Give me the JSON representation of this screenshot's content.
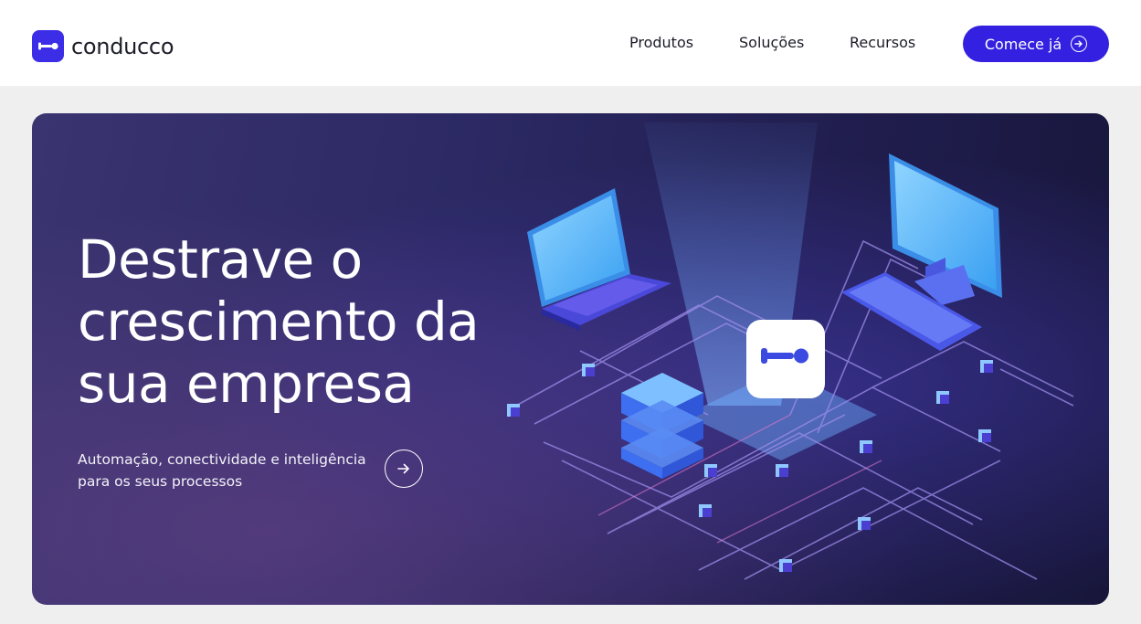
{
  "brand": {
    "name": "conducco",
    "color": "#3b2ee6"
  },
  "nav": {
    "items": [
      {
        "label": "Produtos"
      },
      {
        "label": "Soluções"
      },
      {
        "label": "Recursos"
      }
    ],
    "cta_label": "Comece já",
    "cta_icon": "arrow-right-circle-icon",
    "cta_color": "#3320e0"
  },
  "hero": {
    "title_lines": [
      "Destrave o",
      "crescimento da",
      "sua empresa"
    ],
    "subtitle": "Automação, conectividade e inteligência para os seus processos",
    "arrow_icon": "arrow-right-circle-icon"
  }
}
